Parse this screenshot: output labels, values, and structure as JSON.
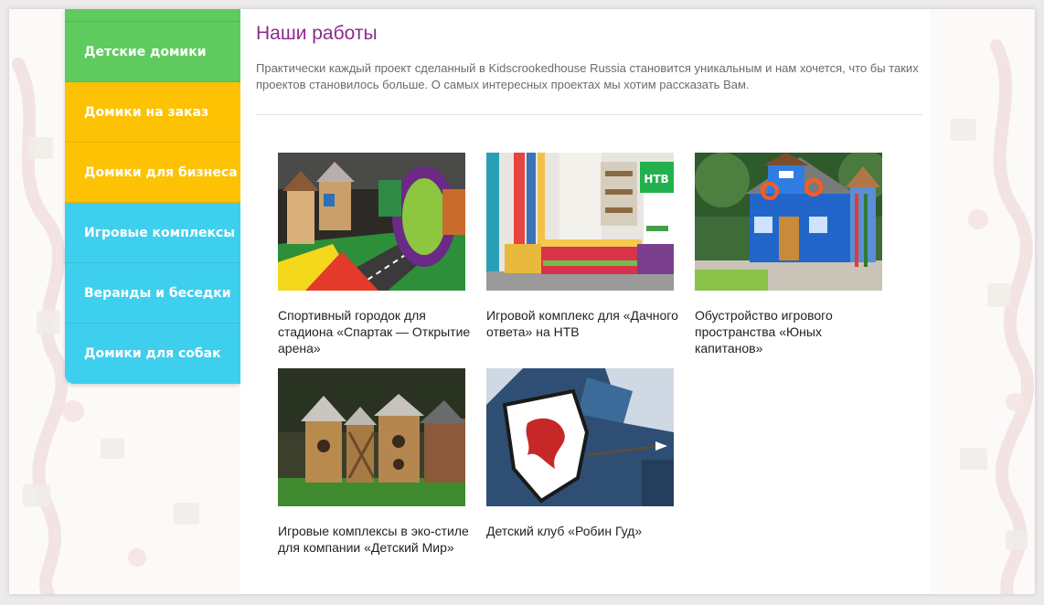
{
  "sidebar": {
    "items": [
      {
        "label": "Детские домики",
        "color": "#5fcb5f"
      },
      {
        "label": "Домики на заказ",
        "color": "#fcc203"
      },
      {
        "label": "Домики для бизнеса",
        "color": "#fcc203"
      },
      {
        "label": "Игровые комплексы",
        "color": "#3fcfee"
      },
      {
        "label": "Веранды и беседки",
        "color": "#3fcfee"
      },
      {
        "label": "Домики для собак",
        "color": "#3fcfee"
      }
    ]
  },
  "main": {
    "title": "Наши работы",
    "intro": "Практически каждый проект сделанный в Kidscrookedhouse Russia становится уникальным и нам хочется, что бы таких проектов становилось больше. О самых интересных проектах мы хотим рассказать Вам.",
    "projects": [
      {
        "caption": "Спортивный городок для стадиона «Спартак — Открытие арена»"
      },
      {
        "caption": "Игровой комплекс для «Дачного ответа» на НТВ",
        "badge": "НТВ"
      },
      {
        "caption": "Обустройство игрового пространства «Юных капитанов»"
      },
      {
        "caption": "Игровые комплексы в эко-стиле для компании «Детский Мир»"
      },
      {
        "caption": "Детский клуб «Робин Гуд»"
      }
    ]
  },
  "colors": {
    "title": "#8b2c8e",
    "green": "#5fcb5f",
    "yellow": "#fcc203",
    "blue": "#3fcfee"
  }
}
